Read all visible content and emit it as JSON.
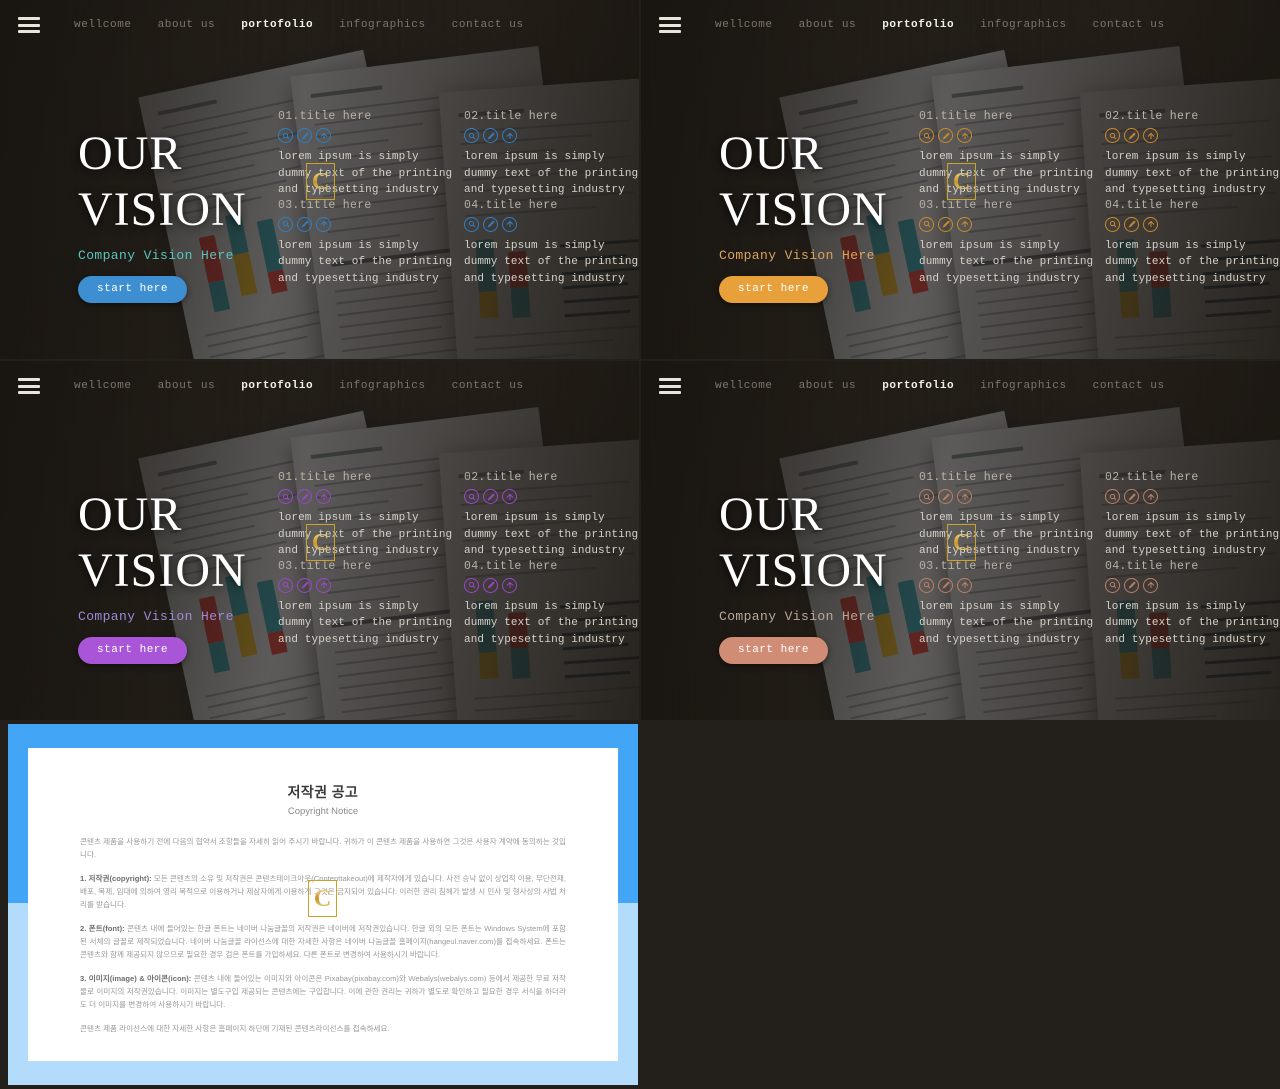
{
  "nav": {
    "menu_icon": "hamburger-icon",
    "items": [
      {
        "label": "wellcome",
        "active": false
      },
      {
        "label": "about us",
        "active": false
      },
      {
        "label": "portofolio",
        "active": true
      },
      {
        "label": "infographics",
        "active": false
      },
      {
        "label": "contact us",
        "active": false
      }
    ]
  },
  "hero": {
    "line1": "OUR",
    "line2": "VISION",
    "subtitle": "Company Vision Here",
    "cta_label": "start here"
  },
  "features": [
    {
      "title": "01.title here",
      "body": "lorem ipsum is simply dummy text of the printing and typesetting industry",
      "icons": [
        "search-icon",
        "edit-icon",
        "share-icon"
      ]
    },
    {
      "title": "02.title here",
      "body": "lorem ipsum is simply dummy text of the printing and typesetting industry",
      "icons": [
        "search-icon",
        "edit-icon",
        "share-icon"
      ]
    },
    {
      "title": "03.title here",
      "body": "lorem ipsum is simply dummy text of the printing and typesetting industry",
      "icons": [
        "search-icon",
        "edit-icon",
        "share-icon"
      ]
    },
    {
      "title": "04.title here",
      "body": "lorem ipsum is simply dummy text of the printing and typesetting industry",
      "icons": [
        "search-icon",
        "edit-icon",
        "share-icon"
      ]
    }
  ],
  "variants": [
    {
      "id": "blue",
      "accent": "#3d8fd1",
      "subtitle_color": "#59c4bd",
      "button_bg": "#3d8fd1",
      "icon_color": "#2f7fc4"
    },
    {
      "id": "orange",
      "accent": "#e8a13a",
      "subtitle_color": "#d8a45f",
      "button_bg": "#e8a13a",
      "icon_color": "#c98a2e"
    },
    {
      "id": "purple",
      "accent": "#a855d8",
      "subtitle_color": "#9c8ad6",
      "button_bg": "#a855d8",
      "icon_color": "#9b46cc"
    },
    {
      "id": "salmon",
      "accent": "#d08c74",
      "subtitle_color": "#b6a99c",
      "button_bg": "#d08c74",
      "icon_color": "#bb7f67"
    }
  ],
  "watermark": {
    "letter": "C",
    "name": "copyright-watermark"
  },
  "copyright_card": {
    "border_color": "#42a5f5",
    "border_color_bottom": "#b3dbfb",
    "title_ko": "저작권 공고",
    "title_en": "Copyright Notice",
    "paragraphs": [
      {
        "lead": "",
        "text": "콘텐츠 제품을 사용하기 전에 다음의 협약서 조항들을 자세히 읽어 주시기 바랍니다. 귀하가 이 콘텐츠 제품을 사용하면 그것은 사용자 계약에 동의하는 것입니다."
      },
      {
        "lead": "1. 저작권(copyright):",
        "text": " 모든 콘텐츠의 소유 및 저작권은 콘텐츠테이크아웃(Contenttakeout)에 제작자에게 있습니다. 사전 승낙 없이 상업적 이용, 무단전재, 배포, 복제, 임대에 의하여 영리 목적으로 이용하거나 제삼자에게 이용하게 그것은 금지되어 있습니다. 이러한 권리 침해가 발생 시 민사 및 형사상의 사법 처리를 받습니다."
      },
      {
        "lead": "2. 폰트(font):",
        "text": " 콘텐츠 내에 들어있는 한글 폰트는 네이버 나눔글꼴의 저작권은 네이버에 저작권있습니다. 한글 외의 모든 폰트는 Windows System에 포함된 서체의 글꼴로 제작되었습니다. 네이버 나눔글꼴 라이선스에 대한 자세한 사항은 네이버 나눔글꼴 홈페이지(hangeul.naver.com)를 접속하세요. 폰트는 콘텐츠와 함께 제공되지 않으므로 필요한 경우 검은 폰트를 가입하세요. 다른 폰트로 변경하여 사용하시기 바랍니다."
      },
      {
        "lead": "3. 이미지(image) & 아이콘(icon):",
        "text": " 콘텐츠 내에 들어있는 이미지와 아이콘은 Pixabay(pixabay.com)와 Webalys(webalys.com) 등에서 제공한 무료 저작물로 이미지의 저작권있습니다. 이미지는 별도구입 제공되는 콘텐츠에는 구입합니다. 이에 관한 권리는 귀하가 별도로 확인하고 필요한 경우 서식을 하더라도 더 이미지를 변경하여 사용하시기 바랍니다."
      },
      {
        "lead": "",
        "text": "콘텐츠 제품 라이선스에 대한 자세한 사항은 홈페이지 하단에 기재된 콘텐츠라이선스를 접속하세요."
      }
    ]
  }
}
